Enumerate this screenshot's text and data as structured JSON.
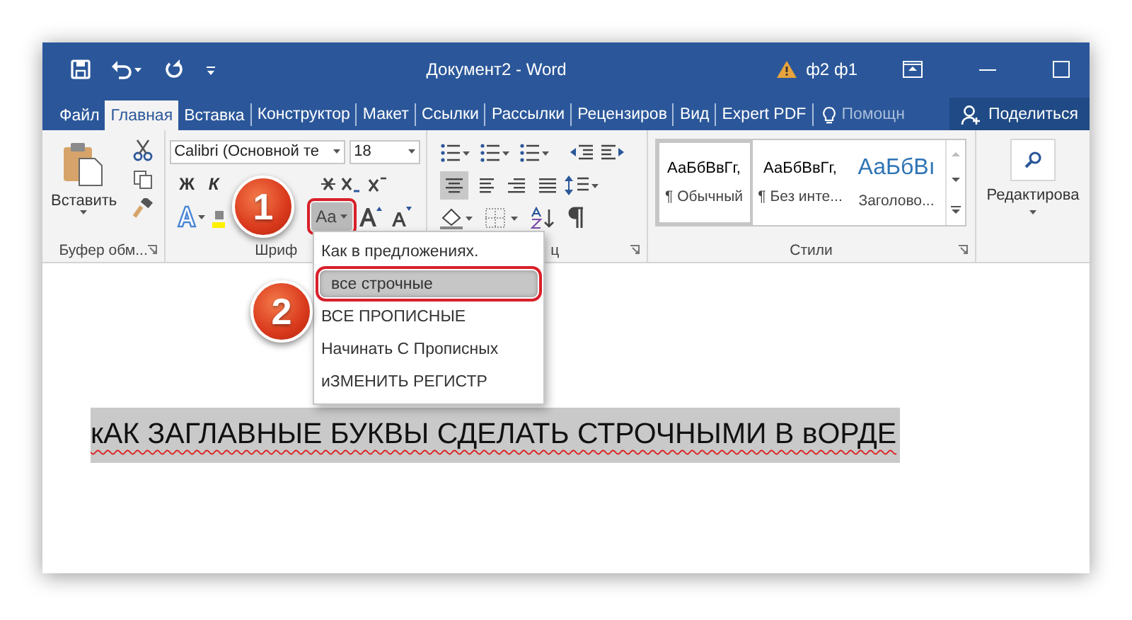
{
  "window": {
    "title": "Документ2 - Word",
    "account": "ф2 ф1"
  },
  "tabs": [
    {
      "label": "Файл",
      "selected": false
    },
    {
      "label": "Главная",
      "selected": true
    },
    {
      "label": "Вставка",
      "selected": false
    },
    {
      "label": "Конструктор",
      "selected": false
    },
    {
      "label": "Макет",
      "selected": false
    },
    {
      "label": "Ссылки",
      "selected": false
    },
    {
      "label": "Рассылки",
      "selected": false
    },
    {
      "label": "Рецензиров",
      "selected": false
    },
    {
      "label": "Вид",
      "selected": false
    },
    {
      "label": "Expert PDF",
      "selected": false
    }
  ],
  "tell_me": {
    "placeholder": "Помощн"
  },
  "share_button": "Поделиться",
  "ribbon": {
    "clipboard": {
      "paste": "Вставить",
      "label": "Буфер обм..."
    },
    "font": {
      "font_name": "Calibri (Основной те",
      "font_size": "18",
      "bold": "Ж",
      "italic": "К",
      "change_case": {
        "label": "Aa",
        "pressed": true,
        "outlined": true
      },
      "label": "Шриф"
    },
    "paragraph": {
      "alignment": [
        {
          "selected": true
        },
        {
          "selected": false
        },
        {
          "selected": false
        },
        {
          "selected": false
        }
      ],
      "label": "ц"
    },
    "styles": {
      "items": [
        {
          "preview": "АаБбВвГг,",
          "name": "¶ Обычный",
          "selected": true,
          "kind": "body"
        },
        {
          "preview": "АаБбВвГг,",
          "name": "¶ Без инте...",
          "selected": false,
          "kind": "body"
        },
        {
          "preview": "АаБбВı",
          "name": "Заголово...",
          "selected": false,
          "kind": "heading"
        }
      ],
      "label": "Стили"
    },
    "editing": {
      "label": "Редактирова"
    }
  },
  "case_menu": {
    "items": [
      {
        "label": "Как в предложениях.",
        "selected": false,
        "outlined": false
      },
      {
        "label": "все строчные",
        "selected": true,
        "outlined": true
      },
      {
        "label": "ВСЕ ПРОПИСНЫЕ",
        "selected": false,
        "outlined": false
      },
      {
        "label": "Начинать С Прописных",
        "selected": false,
        "outlined": false
      },
      {
        "label": "иЗМЕНИТЬ РЕГИСТР",
        "selected": false,
        "outlined": false
      }
    ]
  },
  "callouts": [
    "1",
    "2"
  ],
  "document": {
    "text": "кАК ЗАГЛАВНЫЕ БУКВЫ СДЕЛАТЬ СТРОЧНЫМИ В вОРДЕ",
    "selected": true
  }
}
